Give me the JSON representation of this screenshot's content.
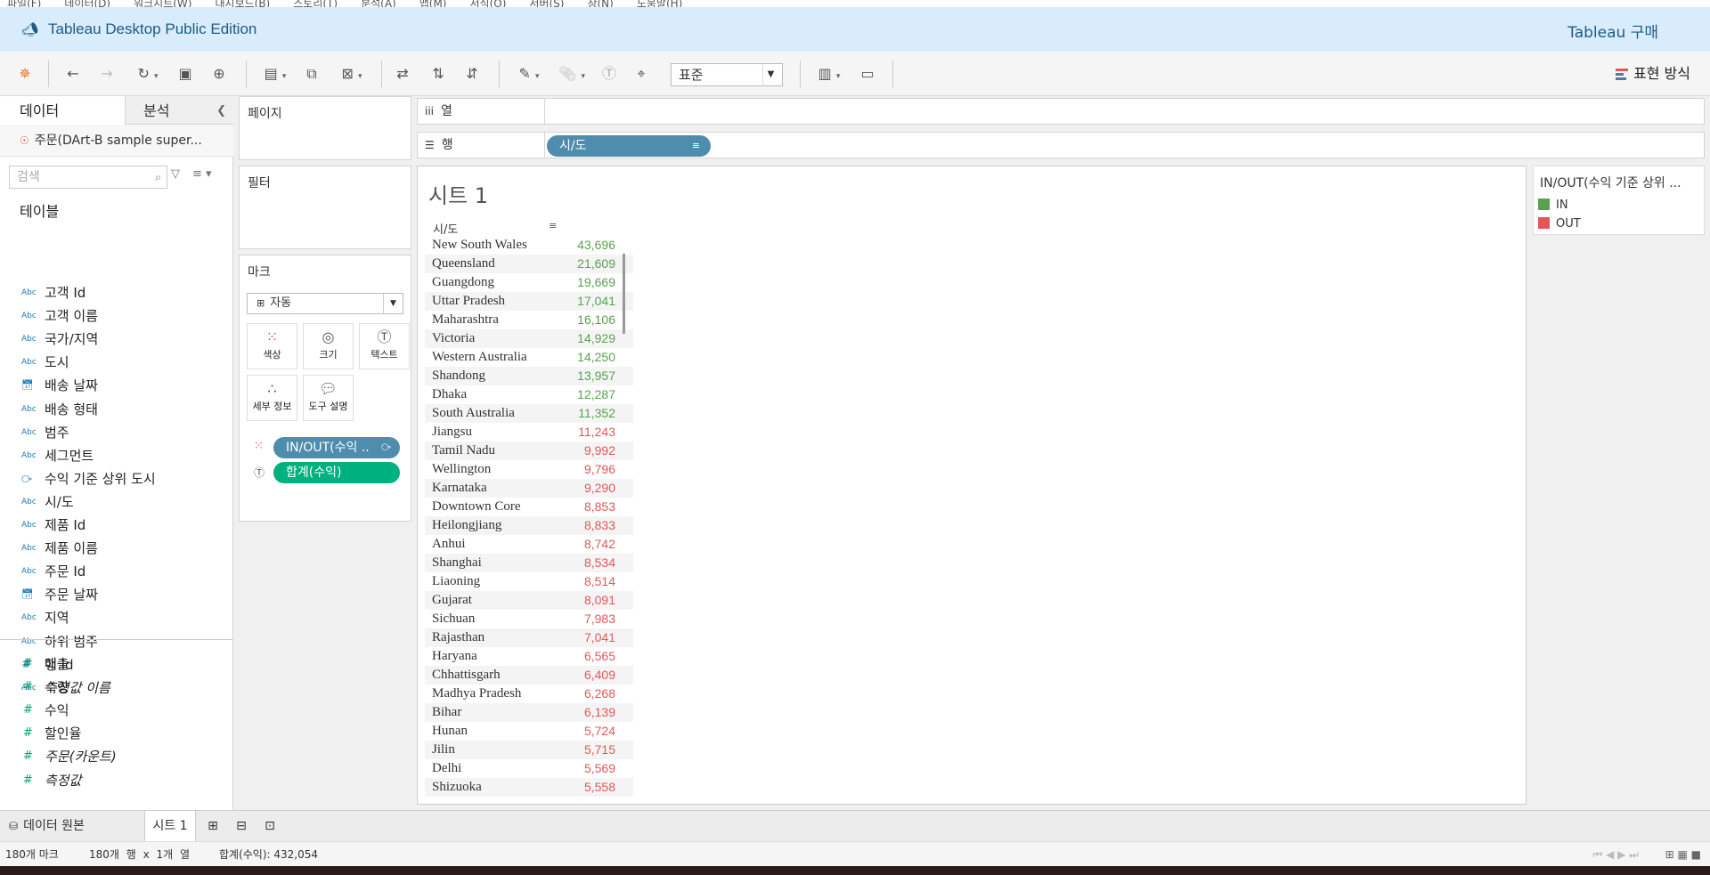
{
  "menu": {
    "items": [
      "파일(F)",
      "데이터(D)",
      "워크시트(W)",
      "대시보드(B)",
      "스토리(T)",
      "분석(A)",
      "맵(M)",
      "서식(O)",
      "서버(S)",
      "창(N)",
      "도움말(H)"
    ]
  },
  "titlebar": {
    "app_name": "Tableau Desktop Public Edition",
    "buy_label": "Tableau 구매"
  },
  "toolbar": {
    "fit_value": "표준",
    "show_me": "표현 방식"
  },
  "left": {
    "tabs": {
      "data": "데이터",
      "analysis": "분석"
    },
    "datasource": "주문(DArt-B sample super...",
    "search_placeholder": "검색",
    "tables_header": "테이블",
    "dimensions": [
      {
        "type": "Abc",
        "name": "고객 Id"
      },
      {
        "type": "Abc",
        "name": "고객 이름"
      },
      {
        "type": "Abc",
        "name": "국가/지역"
      },
      {
        "type": "Abc",
        "name": "도시"
      },
      {
        "type": "cal",
        "name": "배송 날짜"
      },
      {
        "type": "Abc",
        "name": "배송 형태"
      },
      {
        "type": "Abc",
        "name": "범주"
      },
      {
        "type": "Abc",
        "name": "세그먼트"
      },
      {
        "type": "set",
        "name": "수익 기준 상위 도시"
      },
      {
        "type": "Abc",
        "name": "시/도"
      },
      {
        "type": "Abc",
        "name": "제품 Id"
      },
      {
        "type": "Abc",
        "name": "제품 이름"
      },
      {
        "type": "Abc",
        "name": "주문 Id"
      },
      {
        "type": "cal",
        "name": "주문 날짜"
      },
      {
        "type": "Abc",
        "name": "지역"
      },
      {
        "type": "Abc",
        "name": "하위 범주"
      },
      {
        "type": "#",
        "name": "행 Id"
      },
      {
        "type": "Abc",
        "name": "측정값 이름",
        "italic": true
      }
    ],
    "measures": [
      {
        "type": "#",
        "name": "매출"
      },
      {
        "type": "#",
        "name": "수량"
      },
      {
        "type": "#",
        "name": "수익"
      },
      {
        "type": "#",
        "name": "할인율"
      },
      {
        "type": "#",
        "name": "주문(카운트)",
        "italic": true
      },
      {
        "type": "#",
        "name": "측정값",
        "italic": true
      }
    ]
  },
  "cards": {
    "pages": "페이지",
    "filters": "필터",
    "marks": "마크",
    "mark_type": "자동",
    "mark_buttons": {
      "color": "색상",
      "size": "크기",
      "text": "텍스트",
      "detail": "세부 정보",
      "tooltip": "도구 설명"
    },
    "mark_pills": {
      "color_pill": "IN/OUT(수익 ..",
      "text_pill": "합계(수익)"
    }
  },
  "shelves": {
    "columns": "열",
    "rows": "행",
    "row_pill": "시/도"
  },
  "view": {
    "sheet_title": "시트 1",
    "column_header": "시/도",
    "rows": [
      {
        "state": "New South Wales",
        "value": "43,696",
        "in": true
      },
      {
        "state": "Queensland",
        "value": "21,609",
        "in": true
      },
      {
        "state": "Guangdong",
        "value": "19,669",
        "in": true
      },
      {
        "state": "Uttar Pradesh",
        "value": "17,041",
        "in": true
      },
      {
        "state": "Maharashtra",
        "value": "16,106",
        "in": true
      },
      {
        "state": "Victoria",
        "value": "14,929",
        "in": true
      },
      {
        "state": "Western Australia",
        "value": "14,250",
        "in": true
      },
      {
        "state": "Shandong",
        "value": "13,957",
        "in": true
      },
      {
        "state": "Dhaka",
        "value": "12,287",
        "in": true
      },
      {
        "state": "South Australia",
        "value": "11,352",
        "in": true
      },
      {
        "state": "Jiangsu",
        "value": "11,243",
        "in": false
      },
      {
        "state": "Tamil Nadu",
        "value": "9,992",
        "in": false
      },
      {
        "state": "Wellington",
        "value": "9,796",
        "in": false
      },
      {
        "state": "Karnataka",
        "value": "9,290",
        "in": false
      },
      {
        "state": "Downtown Core",
        "value": "8,853",
        "in": false
      },
      {
        "state": "Heilongjiang",
        "value": "8,833",
        "in": false
      },
      {
        "state": "Anhui",
        "value": "8,742",
        "in": false
      },
      {
        "state": "Shanghai",
        "value": "8,534",
        "in": false
      },
      {
        "state": "Liaoning",
        "value": "8,514",
        "in": false
      },
      {
        "state": "Gujarat",
        "value": "8,091",
        "in": false
      },
      {
        "state": "Sichuan",
        "value": "7,983",
        "in": false
      },
      {
        "state": "Rajasthan",
        "value": "7,041",
        "in": false
      },
      {
        "state": "Haryana",
        "value": "6,565",
        "in": false
      },
      {
        "state": "Chhattisgarh",
        "value": "6,409",
        "in": false
      },
      {
        "state": "Madhya Pradesh",
        "value": "6,268",
        "in": false
      },
      {
        "state": "Bihar",
        "value": "6,139",
        "in": false
      },
      {
        "state": "Hunan",
        "value": "5,724",
        "in": false
      },
      {
        "state": "Jilin",
        "value": "5,715",
        "in": false
      },
      {
        "state": "Delhi",
        "value": "5,569",
        "in": false
      },
      {
        "state": "Shizuoka",
        "value": "5,558",
        "in": false
      }
    ]
  },
  "legend": {
    "title": "IN/OUT(수익 기준 상위 ...",
    "items": [
      {
        "label": "IN",
        "color": "#59a14f"
      },
      {
        "label": "OUT",
        "color": "#e15759"
      }
    ]
  },
  "colors": {
    "in": "#59a14f",
    "out": "#e15759",
    "pill_dim": "#4e8dad",
    "pill_measure": "#00b180",
    "title_bg": "#d8ecfc",
    "title_fg": "#1f5b84"
  },
  "sheet_tabs": {
    "datasource": "데이터 원본",
    "sheet1": "시트 1"
  },
  "status": {
    "marks": "180개 마크",
    "rows_cols": "180개 행 x 1개 열",
    "sum": "합계(수익): 432,054"
  }
}
